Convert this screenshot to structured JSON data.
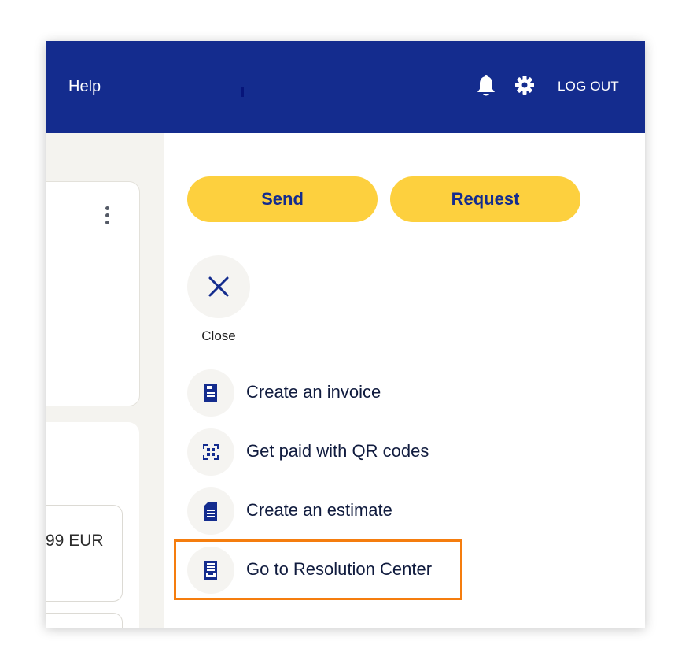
{
  "header": {
    "help_label": "Help",
    "logout_label": "LOG OUT",
    "icons": [
      "bell-icon",
      "gear-icon"
    ]
  },
  "left": {
    "amount_text": "99 EUR"
  },
  "actions": {
    "send_label": "Send",
    "request_label": "Request"
  },
  "close": {
    "label": "Close",
    "icon": "close-icon"
  },
  "menu": {
    "items": [
      {
        "label": "Create an invoice",
        "icon": "invoice-icon"
      },
      {
        "label": "Get paid with QR codes",
        "icon": "qr-code-icon"
      },
      {
        "label": "Create an estimate",
        "icon": "estimate-icon"
      },
      {
        "label": "Go to Resolution Center",
        "icon": "resolution-center-icon"
      }
    ],
    "highlighted_item": "Go to Resolution Center"
  },
  "colors": {
    "header_bg": "#142c8e",
    "button_bg": "#fdd03e",
    "button_text": "#142c8e",
    "highlight_border": "#f57d0e",
    "icon_color": "#142c8e"
  }
}
